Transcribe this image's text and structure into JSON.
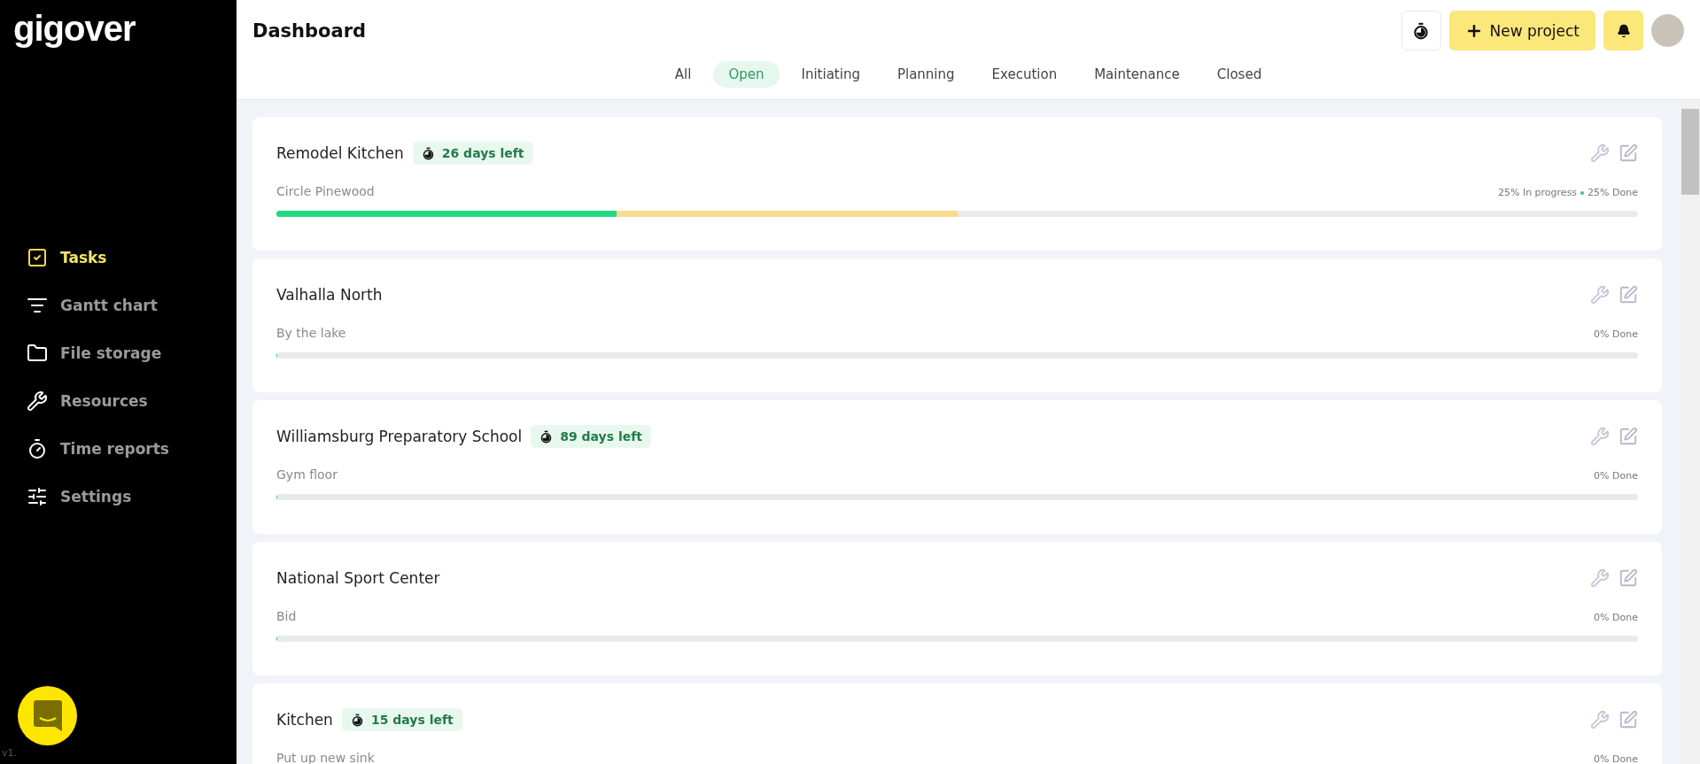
{
  "sidebar": {
    "logo": "gigover",
    "items": [
      {
        "label": "Tasks",
        "selected": true
      },
      {
        "label": "Gantt chart",
        "selected": false
      },
      {
        "label": "File storage",
        "selected": false
      },
      {
        "label": "Resources",
        "selected": false
      },
      {
        "label": "Time reports",
        "selected": false
      },
      {
        "label": "Settings",
        "selected": false
      }
    ],
    "version": "v1."
  },
  "header": {
    "title": "Dashboard",
    "new_project": "New project"
  },
  "tabs": [
    {
      "label": "All",
      "selected": false
    },
    {
      "label": "Open",
      "selected": true
    },
    {
      "label": "Initiating",
      "selected": false
    },
    {
      "label": "Planning",
      "selected": false
    },
    {
      "label": "Execution",
      "selected": false
    },
    {
      "label": "Maintenance",
      "selected": false
    },
    {
      "label": "Closed",
      "selected": false
    }
  ],
  "projects": [
    {
      "name": "Remodel Kitchen",
      "badge": "26 days left",
      "subtitle": "Circle Pinewood",
      "status": "25% In progress",
      "status_done": "25% Done",
      "done": {
        "level": 0.25
      },
      "in_progress": {
        "level": 0.5
      }
    },
    {
      "name": "Valhalla North",
      "subtitle": "By the lake",
      "status_done": "0% Done",
      "done": {
        "level": 0
      }
    },
    {
      "name": "Williamsburg Preparatory School",
      "badge": "89 days left",
      "subtitle": "Gym floor",
      "status_done": "0% Done",
      "done": {
        "level": 0
      }
    },
    {
      "name": "National Sport Center",
      "subtitle": "Bid",
      "status_done": "0% Done",
      "done": {
        "level": 0
      }
    },
    {
      "name": "Kitchen",
      "badge": "15 days left",
      "subtitle": "Put up new sink",
      "status_done": "0% Done"
    }
  ]
}
